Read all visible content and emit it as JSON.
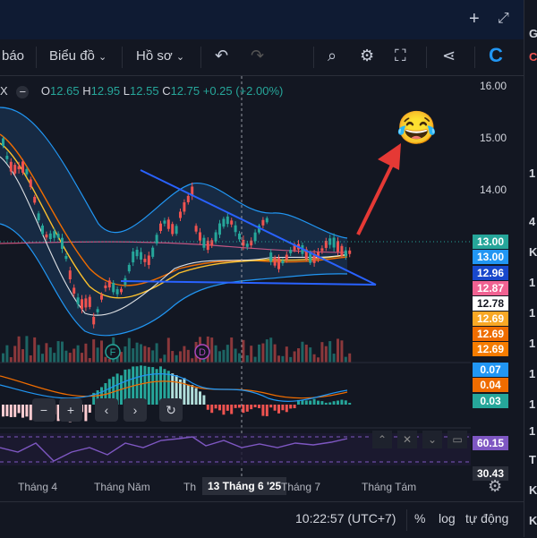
{
  "toolbar": {
    "bao_label": "báo",
    "bieudo_label": "Biểu đồ",
    "hoso_label": "Hồ sơ"
  },
  "legend": {
    "close_x": "X",
    "o_key": "O",
    "o_val": "12.65",
    "h_key": "H",
    "h_val": "12.95",
    "l_key": "L",
    "l_val": "12.55",
    "c_key": "C",
    "c_val": "12.75",
    "change": "+0.25 (+2.00%)"
  },
  "price_axis": [
    "16.00",
    "15.00",
    "14.00",
    "4",
    "13.00",
    "12.78"
  ],
  "price_badges": [
    {
      "text": "13.00",
      "color": "#26a69a"
    },
    {
      "text": "13.00",
      "color": "#2196f3"
    },
    {
      "text": "12.96",
      "color": "#1848cc"
    },
    {
      "text": "12.87",
      "color": "#f06292"
    },
    {
      "text": "12.78",
      "color": "#ffffff",
      "fg": "#131722"
    },
    {
      "text": "12.69",
      "color": "#f9a825"
    },
    {
      "text": "12.69",
      "color": "#ef6c00"
    },
    {
      "text": "12.69",
      "color": "#f57c00"
    }
  ],
  "macd_badges": [
    {
      "text": "0.07",
      "color": "#2196f3"
    },
    {
      "text": "0.04",
      "color": "#ef6c00"
    },
    {
      "text": "0.03",
      "color": "#26a69a"
    }
  ],
  "rsi_badges": [
    {
      "text": "60.15",
      "color": "#7e57c2"
    },
    {
      "text": "30.43",
      "color": "#2a2e39"
    }
  ],
  "x_axis": {
    "thang4": "Tháng 4",
    "thangnam": "Tháng Năm",
    "tha": "Th",
    "crosshair_date": "13 Tháng 6 '25",
    "thang7": "Tháng 7",
    "thangtam": "Tháng Tám"
  },
  "markers": {
    "f": "F",
    "d": "D"
  },
  "bottom": {
    "time": "10:22:57 (UTC+7)",
    "percent": "%",
    "log": "log",
    "auto": "tự động"
  },
  "right_panel": [
    "G",
    "C",
    "1",
    "4",
    "K",
    "1",
    "1",
    "1",
    "1",
    "1",
    "1",
    "T",
    "K",
    "K"
  ],
  "emoji": "😂",
  "colors": {
    "up": "#26a69a",
    "down": "#ef5350",
    "trendline": "#2962ff",
    "arrow": "#e53935"
  }
}
